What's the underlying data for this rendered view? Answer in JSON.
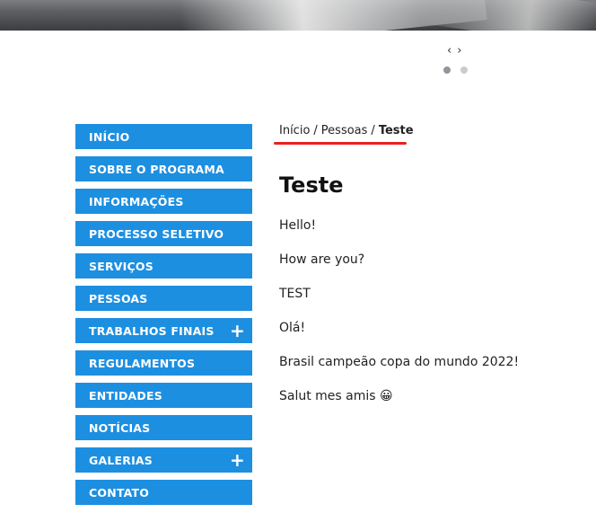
{
  "slider": {
    "prev_label": "‹",
    "next_label": "›",
    "dots": 2,
    "active_dot": 1
  },
  "nav": {
    "items": [
      {
        "label": "INÍCIO",
        "has_submenu": false
      },
      {
        "label": "SOBRE O PROGRAMA",
        "has_submenu": false
      },
      {
        "label": "INFORMAÇÕES",
        "has_submenu": false
      },
      {
        "label": "PROCESSO SELETIVO",
        "has_submenu": false
      },
      {
        "label": "SERVIÇOS",
        "has_submenu": false
      },
      {
        "label": "PESSOAS",
        "has_submenu": false
      },
      {
        "label": "TRABALHOS FINAIS",
        "has_submenu": true
      },
      {
        "label": "REGULAMENTOS",
        "has_submenu": false
      },
      {
        "label": "ENTIDADES",
        "has_submenu": false
      },
      {
        "label": "NOTÍCIAS",
        "has_submenu": false
      },
      {
        "label": "GALERIAS",
        "has_submenu": true
      },
      {
        "label": "CONTATO",
        "has_submenu": false
      }
    ],
    "expand_symbol": "+"
  },
  "breadcrumb": {
    "home": "Início",
    "section": "Pessoas",
    "current": "Teste",
    "separator": "/"
  },
  "page": {
    "title": "Teste",
    "paragraphs": [
      "Hello!",
      "How are you?",
      "TEST",
      "Olá!",
      "Brasil campeão copa do mundo 2022!",
      "Salut mes amis 😀"
    ]
  },
  "colors": {
    "nav_bg": "#1d8fe1",
    "highlight_underline": "#e8231c"
  }
}
